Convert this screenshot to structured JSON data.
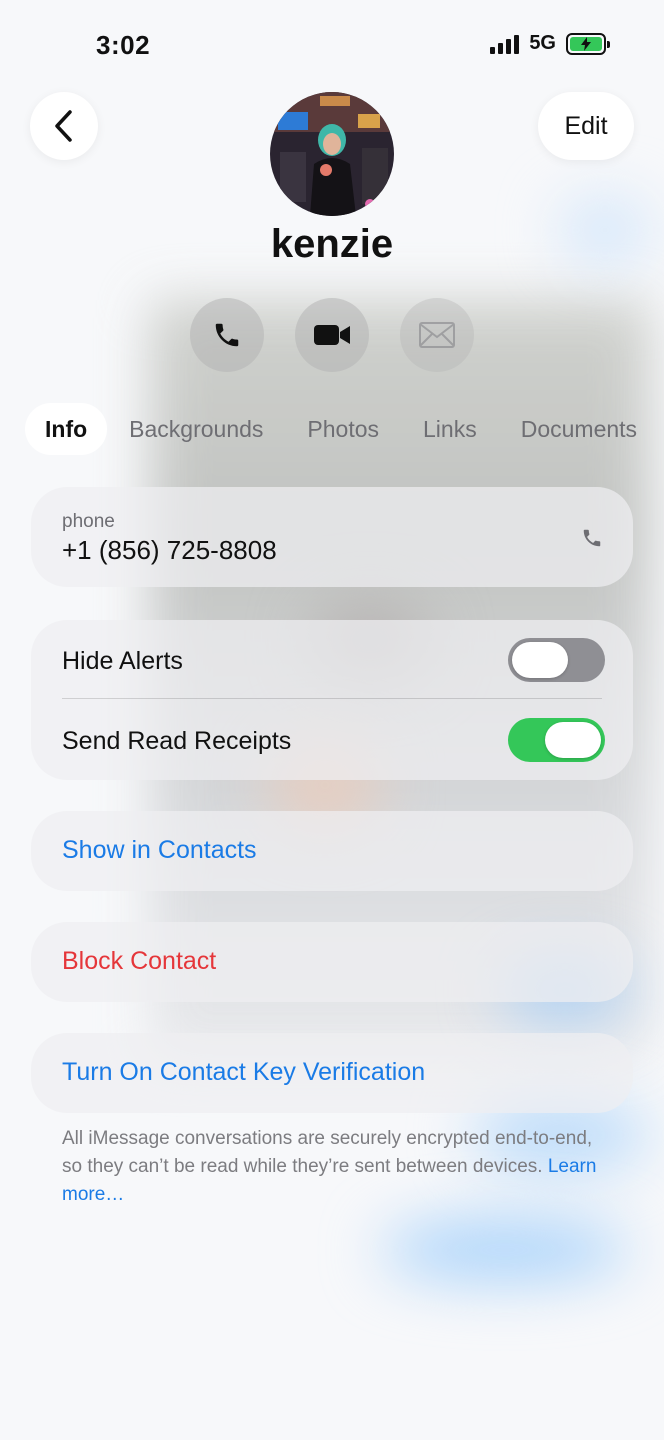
{
  "status_bar": {
    "time": "3:02",
    "network": "5G",
    "battery_charging": true
  },
  "nav": {
    "back_icon": "chevron-left-icon",
    "edit_label": "Edit"
  },
  "contact": {
    "name": "kenzie",
    "avatar": "photo"
  },
  "actions": [
    {
      "icon": "phone-icon"
    },
    {
      "icon": "video-icon"
    },
    {
      "icon": "mail-icon"
    }
  ],
  "tabs": [
    {
      "label": "Info",
      "active": true
    },
    {
      "label": "Backgrounds",
      "active": false
    },
    {
      "label": "Photos",
      "active": false
    },
    {
      "label": "Links",
      "active": false
    },
    {
      "label": "Documents",
      "active": false
    }
  ],
  "phone": {
    "label": "phone",
    "number": "+1 (856) 725-8808"
  },
  "settings": {
    "hide_alerts": {
      "label": "Hide Alerts",
      "on": false
    },
    "read_receipts": {
      "label": "Send Read Receipts",
      "on": true
    }
  },
  "links": {
    "show_contacts": "Show in Contacts",
    "block_contact": "Block Contact",
    "key_verification": "Turn On Contact Key Verification"
  },
  "footnote": {
    "text": "All iMessage conversations are securely encrypted end-to-end, so they can’t be read while they’re sent between devices.",
    "link": "Learn more…"
  },
  "colors": {
    "accent": "#1a7be6",
    "destructive": "#e5363a",
    "toggle_on": "#34c759"
  }
}
